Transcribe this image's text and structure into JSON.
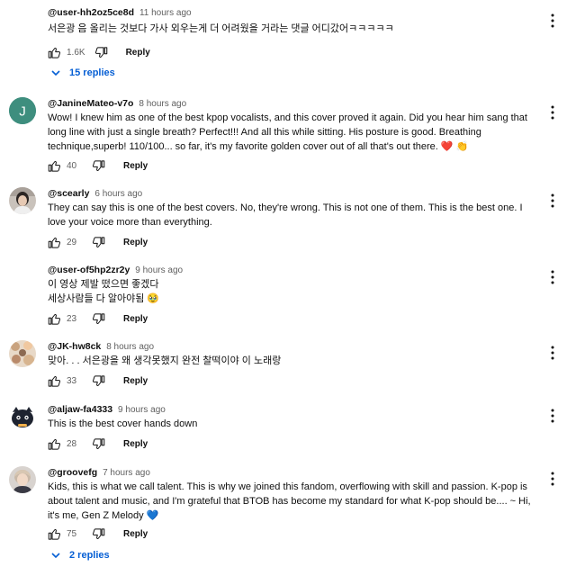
{
  "labels": {
    "reply": "Reply"
  },
  "colors": {
    "link": "#065fd4",
    "heart": "#e53935",
    "blue_heart": "#2196f3"
  },
  "comments": [
    {
      "author": "@user-hh2oz5ce8d",
      "time": "11 hours ago",
      "text": "서은광 음 올리는 것보다 가사 외우는게 더 어려웠을 거라는 댓글 어디갔어ㅋㅋㅋㅋㅋ",
      "likes": "1.6K",
      "replies_label": "15 replies",
      "avatar": "none"
    },
    {
      "author": "@JanineMateo-v7o",
      "time": "8 hours ago",
      "text": "Wow! I knew him as one of the best kpop vocalists,  and this cover proved it again. Did you hear him sang that long line with just a single breath? Perfect!!! And all this while sitting. His posture is good. Breathing technique,superb! 110/100... so far, it's my favorite golden cover out of all that's out there. ❤️ 👏",
      "likes": "40",
      "avatar": "letter-J",
      "avatar_letter": "J"
    },
    {
      "author": "@scearly",
      "time": "6 hours ago",
      "text": "They can say this is one of the best covers. No, they're wrong. This is not one of them. This is the best one. I love your voice more than everything.",
      "likes": "29",
      "avatar": "photo-person"
    },
    {
      "author": "@user-of5hp2zr2y",
      "time": "9 hours ago",
      "text": "이 영상 제발 떴으면 좋겠다\n세상사람들 다 알아야됨 🥹",
      "likes": "23",
      "avatar": "none"
    },
    {
      "author": "@JK-hw8ck",
      "time": "8 hours ago",
      "text": "맞아. . . 서은광을 왜 생각못했지 완전 찰떡이야 이 노래랑",
      "likes": "33",
      "avatar": "photo-collage"
    },
    {
      "author": "@aljaw-fa4333",
      "time": "9 hours ago",
      "text": "This is the best cover hands down",
      "likes": "28",
      "avatar": "cartoon-character"
    },
    {
      "author": "@groovefg",
      "time": "7 hours ago",
      "text": "Kids, this is what we call talent. This is why we joined this fandom, overflowing with skill and passion. K-pop is about talent and music, and I'm grateful that BTOB has become my standard for what K-pop should be.... ~ Hi, it's me, Gen Z Melody 💙",
      "likes": "75",
      "replies_label": "2 replies",
      "avatar": "photo-person-2"
    }
  ]
}
